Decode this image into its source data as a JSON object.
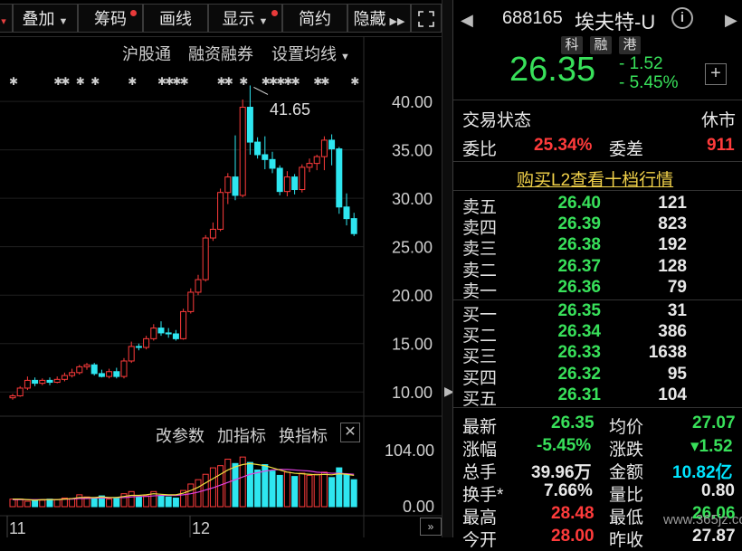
{
  "toolbar": {
    "overlay": "叠加",
    "chips": "筹码",
    "draw": "画线",
    "display": "显示",
    "simple": "简约",
    "hide": "隐藏"
  },
  "chart_menu": {
    "hk_connect": "沪股通",
    "margin": "融资融券",
    "ma_settings": "设置均线"
  },
  "chart_data": [
    {
      "type": "candlestick",
      "title": "",
      "ylim": [
        7.5,
        43
      ],
      "y_ticks": [
        "40.00",
        "35.00",
        "30.00",
        "25.00",
        "20.00",
        "15.00",
        "10.00"
      ],
      "x_ticks": [
        "11",
        "12"
      ],
      "high_marker": "41.65",
      "candles": [
        {
          "o": 9.4,
          "h": 9.8,
          "l": 9.2,
          "c": 9.6
        },
        {
          "o": 9.6,
          "h": 10.6,
          "l": 9.5,
          "c": 10.4
        },
        {
          "o": 10.4,
          "h": 11.6,
          "l": 10.2,
          "c": 11.2
        },
        {
          "o": 11.2,
          "h": 11.5,
          "l": 10.6,
          "c": 10.9
        },
        {
          "o": 10.9,
          "h": 11.4,
          "l": 10.7,
          "c": 11.2
        },
        {
          "o": 11.2,
          "h": 11.5,
          "l": 10.7,
          "c": 11.0
        },
        {
          "o": 11.0,
          "h": 11.6,
          "l": 10.9,
          "c": 11.3
        },
        {
          "o": 11.3,
          "h": 12.0,
          "l": 11.1,
          "c": 11.7
        },
        {
          "o": 11.7,
          "h": 12.4,
          "l": 11.5,
          "c": 12.0
        },
        {
          "o": 12.0,
          "h": 12.8,
          "l": 11.8,
          "c": 12.6
        },
        {
          "o": 12.6,
          "h": 13.0,
          "l": 12.3,
          "c": 12.8
        },
        {
          "o": 12.8,
          "h": 13.0,
          "l": 11.7,
          "c": 11.9
        },
        {
          "o": 11.9,
          "h": 12.3,
          "l": 11.5,
          "c": 11.6
        },
        {
          "o": 11.6,
          "h": 12.4,
          "l": 11.4,
          "c": 12.1
        },
        {
          "o": 12.1,
          "h": 12.5,
          "l": 11.4,
          "c": 11.6
        },
        {
          "o": 11.6,
          "h": 13.5,
          "l": 11.4,
          "c": 13.2
        },
        {
          "o": 13.2,
          "h": 15.2,
          "l": 13.0,
          "c": 14.7
        },
        {
          "o": 14.7,
          "h": 15.0,
          "l": 14.3,
          "c": 14.6
        },
        {
          "o": 14.6,
          "h": 15.8,
          "l": 14.4,
          "c": 15.5
        },
        {
          "o": 15.5,
          "h": 17.0,
          "l": 15.3,
          "c": 16.6
        },
        {
          "o": 16.6,
          "h": 17.3,
          "l": 15.8,
          "c": 16.1
        },
        {
          "o": 16.1,
          "h": 16.6,
          "l": 15.6,
          "c": 16.0
        },
        {
          "o": 16.0,
          "h": 16.4,
          "l": 15.3,
          "c": 15.5
        },
        {
          "o": 15.5,
          "h": 18.6,
          "l": 15.4,
          "c": 18.3
        },
        {
          "o": 18.3,
          "h": 20.7,
          "l": 18.1,
          "c": 20.3
        },
        {
          "o": 20.3,
          "h": 22.1,
          "l": 20.0,
          "c": 21.6
        },
        {
          "o": 21.6,
          "h": 26.2,
          "l": 21.4,
          "c": 25.9
        },
        {
          "o": 25.9,
          "h": 27.5,
          "l": 25.6,
          "c": 26.8
        },
        {
          "o": 26.8,
          "h": 31.0,
          "l": 26.6,
          "c": 30.6
        },
        {
          "o": 30.6,
          "h": 32.6,
          "l": 29.4,
          "c": 32.2
        },
        {
          "o": 32.2,
          "h": 36.5,
          "l": 29.8,
          "c": 30.3
        },
        {
          "o": 30.3,
          "h": 40.2,
          "l": 30.1,
          "c": 39.4
        },
        {
          "o": 39.4,
          "h": 41.65,
          "l": 34.5,
          "c": 35.8
        },
        {
          "o": 35.8,
          "h": 36.3,
          "l": 34.1,
          "c": 34.5
        },
        {
          "o": 34.5,
          "h": 36.4,
          "l": 33.0,
          "c": 34.0
        },
        {
          "o": 34.0,
          "h": 34.8,
          "l": 32.6,
          "c": 33.1
        },
        {
          "o": 33.1,
          "h": 33.4,
          "l": 30.3,
          "c": 30.7
        },
        {
          "o": 30.7,
          "h": 32.8,
          "l": 30.2,
          "c": 32.2
        },
        {
          "o": 32.2,
          "h": 32.5,
          "l": 30.4,
          "c": 30.9
        },
        {
          "o": 30.9,
          "h": 33.5,
          "l": 30.6,
          "c": 33.2
        },
        {
          "o": 33.2,
          "h": 34.1,
          "l": 32.7,
          "c": 33.6
        },
        {
          "o": 33.6,
          "h": 34.5,
          "l": 32.9,
          "c": 34.3
        },
        {
          "o": 34.3,
          "h": 36.4,
          "l": 32.9,
          "c": 36.0
        },
        {
          "o": 36.0,
          "h": 36.6,
          "l": 33.4,
          "c": 35.1
        },
        {
          "o": 35.1,
          "h": 35.3,
          "l": 28.4,
          "c": 29.1
        },
        {
          "o": 29.1,
          "h": 30.5,
          "l": 27.2,
          "c": 27.9
        },
        {
          "o": 27.9,
          "h": 28.5,
          "l": 26.1,
          "c": 26.35
        }
      ]
    },
    {
      "type": "bar",
      "title": "",
      "ylim": [
        0,
        104
      ],
      "y_ticks": [
        "104.00",
        "0.00"
      ],
      "controls": {
        "edit": "改参数",
        "add": "加指标",
        "change": "换指标"
      },
      "volumes": [
        14,
        14,
        10,
        12,
        12,
        14,
        13,
        16,
        15,
        22,
        18,
        16,
        20,
        14,
        15,
        24,
        28,
        18,
        20,
        28,
        20,
        18,
        16,
        30,
        42,
        50,
        60,
        72,
        76,
        88,
        80,
        92,
        82,
        68,
        78,
        66,
        58,
        64,
        56,
        62,
        58,
        60,
        64,
        54,
        72,
        60,
        50
      ],
      "ma_fast": [
        14,
        14,
        13,
        12,
        13,
        13,
        13,
        14,
        15,
        17,
        17,
        17,
        18,
        17,
        17,
        19,
        21,
        21,
        22,
        24,
        23,
        22,
        22,
        25,
        30,
        36,
        44,
        52,
        60,
        68,
        74,
        78,
        80,
        78,
        76,
        72,
        68,
        64,
        62,
        61,
        60,
        59,
        60,
        59,
        61,
        60,
        58
      ],
      "ma_slow": [
        13,
        13,
        13,
        13,
        13,
        13,
        13,
        14,
        14,
        15,
        15,
        16,
        16,
        16,
        17,
        17,
        18,
        19,
        19,
        20,
        21,
        21,
        21,
        22,
        24,
        27,
        31,
        35,
        40,
        45,
        50,
        55,
        60,
        63,
        66,
        68,
        69,
        69,
        68,
        67,
        66,
        64,
        63,
        62,
        62,
        61,
        60
      ]
    }
  ],
  "quote": {
    "code": "688165",
    "name": "埃夫特-U",
    "tags": [
      "科",
      "融",
      "港"
    ],
    "price": "26.35",
    "change": "- 1.52",
    "change_pct": "- 5.45%",
    "trade_status_label": "交易状态",
    "trade_status": "休市",
    "wb_label": "委比",
    "wb_value": "25.34%",
    "wc_label": "委差",
    "wc_value": "911",
    "l2_link": "购买L2查看十档行情"
  },
  "order_book": {
    "asks": [
      {
        "label": "卖五",
        "price": "26.40",
        "vol": "121"
      },
      {
        "label": "卖四",
        "price": "26.39",
        "vol": "823"
      },
      {
        "label": "卖三",
        "price": "26.38",
        "vol": "192"
      },
      {
        "label": "卖二",
        "price": "26.37",
        "vol": "128"
      },
      {
        "label": "卖一",
        "price": "26.36",
        "vol": "79"
      }
    ],
    "bids": [
      {
        "label": "买一",
        "price": "26.35",
        "vol": "31"
      },
      {
        "label": "买二",
        "price": "26.34",
        "vol": "386"
      },
      {
        "label": "买三",
        "price": "26.33",
        "vol": "1638"
      },
      {
        "label": "买四",
        "price": "26.32",
        "vol": "95"
      },
      {
        "label": "买五",
        "price": "26.31",
        "vol": "104"
      }
    ]
  },
  "stats": {
    "latest_label": "最新",
    "latest": "26.35",
    "avg_label": "均价",
    "avg": "27.07",
    "pct_label": "涨幅",
    "pct": "-5.45%",
    "chg_label": "涨跌",
    "chg": "▾1.52",
    "vol_label": "总手",
    "vol": "39.96万",
    "amt_label": "金额",
    "amt": "10.82亿",
    "turn_label": "换手*",
    "turn": "7.66%",
    "ratio_label": "量比",
    "ratio": "0.80",
    "high_label": "最高",
    "high": "28.48",
    "low_label": "最低",
    "low": "26.06",
    "open_label": "今开",
    "open": "28.00",
    "prev_label": "昨收",
    "prev": "27.87"
  },
  "watermark": "www.365jz.com"
}
